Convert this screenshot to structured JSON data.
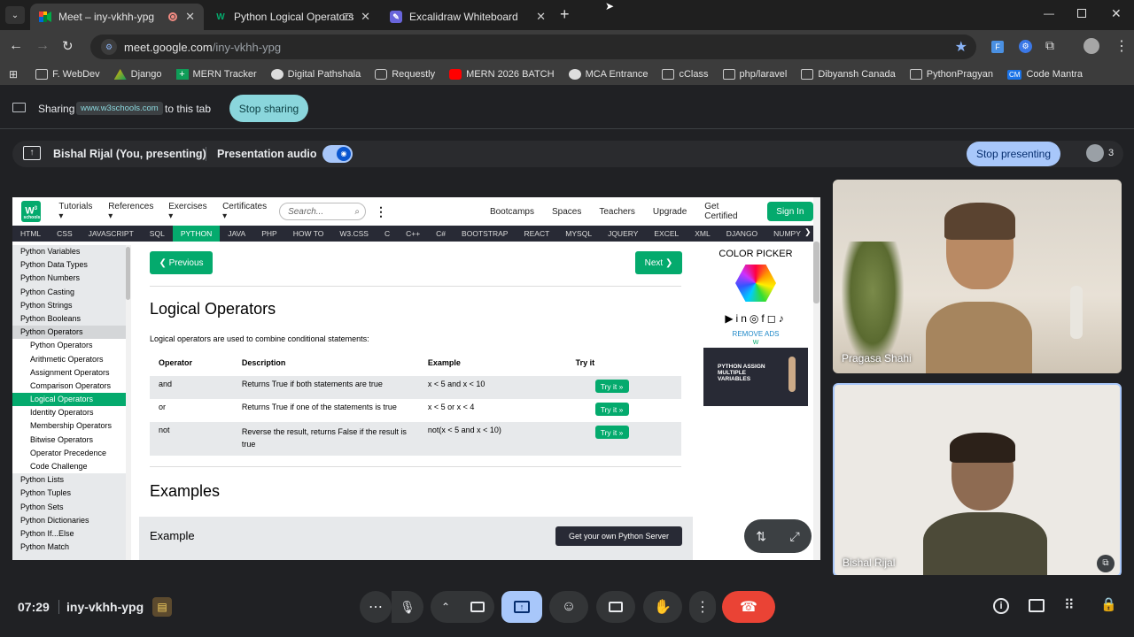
{
  "browser": {
    "tabs": [
      {
        "title": "Meet – iny-vkhh-ypg",
        "active": true
      },
      {
        "title": "Python Logical Operators",
        "active": false
      },
      {
        "title": "Excalidraw Whiteboard",
        "active": false
      }
    ],
    "url_host": "meet.google.com",
    "url_path": "/iny-vkhh-ypg",
    "bookmarks": [
      "F. WebDev",
      "Django",
      "MERN Tracker",
      "Digital Pathshala",
      "Requestly",
      "MERN 2026 BATCH",
      "MCA Entrance",
      "cClass",
      "php/laravel",
      "Dibyansh Canada",
      "PythonPragyan",
      "Code Mantra"
    ],
    "bookmark_cm_badge": "CM"
  },
  "sharing": {
    "label": "Sharing",
    "site": "www.w3schools.com",
    "suffix": "to this tab",
    "stop": "Stop sharing"
  },
  "present": {
    "presenter": "Bishal Rijal (You, presenting)",
    "audio": "Presentation audio",
    "stop": "Stop presenting",
    "participants": "3"
  },
  "w3": {
    "logo_sup": "3",
    "logo_text": "schools",
    "menu": [
      "Tutorials",
      "References",
      "Exercises",
      "Certificates"
    ],
    "search_placeholder": "Search...",
    "right_links": [
      "Bootcamps",
      "Spaces",
      "Teachers",
      "Upgrade",
      "Get Certified"
    ],
    "signin": "Sign In",
    "nav": [
      "HTML",
      "CSS",
      "JAVASCRIPT",
      "SQL",
      "PYTHON",
      "JAVA",
      "PHP",
      "HOW TO",
      "W3.CSS",
      "C",
      "C++",
      "C#",
      "BOOTSTRAP",
      "REACT",
      "MYSQL",
      "JQUERY",
      "EXCEL",
      "XML",
      "DJANGO",
      "NUMPY"
    ],
    "sidebar": [
      {
        "label": "Python Variables",
        "sub": false
      },
      {
        "label": "Python Data Types",
        "sub": false
      },
      {
        "label": "Python Numbers",
        "sub": false
      },
      {
        "label": "Python Casting",
        "sub": false
      },
      {
        "label": "Python Strings",
        "sub": false
      },
      {
        "label": "Python Booleans",
        "sub": false
      },
      {
        "label": "Python Operators",
        "sub": false
      },
      {
        "label": "Python Operators",
        "sub": true
      },
      {
        "label": "Arithmetic Operators",
        "sub": true
      },
      {
        "label": "Assignment Operators",
        "sub": true
      },
      {
        "label": "Comparison Operators",
        "sub": true
      },
      {
        "label": "Logical Operators",
        "sub": true,
        "active": true
      },
      {
        "label": "Identity Operators",
        "sub": true
      },
      {
        "label": "Membership Operators",
        "sub": true
      },
      {
        "label": "Bitwise Operators",
        "sub": true
      },
      {
        "label": "Operator Precedence",
        "sub": true
      },
      {
        "label": "Code Challenge",
        "sub": true
      },
      {
        "label": "Python Lists",
        "sub": false
      },
      {
        "label": "Python Tuples",
        "sub": false
      },
      {
        "label": "Python Sets",
        "sub": false
      },
      {
        "label": "Python Dictionaries",
        "sub": false
      },
      {
        "label": "Python If...Else",
        "sub": false
      },
      {
        "label": "Python Match",
        "sub": false
      }
    ],
    "prev": "❮ Previous",
    "next": "Next ❯",
    "heading": "Logical Operators",
    "intro": "Logical operators are used to combine conditional statements:",
    "table_headers": [
      "Operator",
      "Description",
      "Example",
      "Try it"
    ],
    "rows": [
      {
        "op": "and",
        "desc": "Returns True if both statements are true",
        "ex": "x < 5 and  x < 10",
        "try": "Try it »"
      },
      {
        "op": "or",
        "desc": "Returns True if one of the statements is true",
        "ex": "x < 5 or x < 4",
        "try": "Try it »"
      },
      {
        "op": "not",
        "desc": "Reverse the result, returns False if the result is true",
        "ex": "not(x < 5 and x < 10)",
        "try": "Try it »"
      }
    ],
    "examples": "Examples",
    "example_title": "Example",
    "server_btn": "Get your own Python Server",
    "color_picker": "COLOR PICKER",
    "remove_ads": "REMOVE ADS",
    "ad_text": "PYTHON ASSIGN MULTIPLE VARIABLES"
  },
  "participants": [
    {
      "name": "Pragasa Shahi"
    },
    {
      "name": "Bishal Rijal"
    }
  ],
  "footer": {
    "time": "07:29",
    "meeting": "iny-vkhh-ypg"
  },
  "colors": {
    "w3green": "#04aa6d",
    "hangup": "#ea4335",
    "share_pill": "#8ad6dc",
    "present_blue": "#a8c7fa"
  }
}
